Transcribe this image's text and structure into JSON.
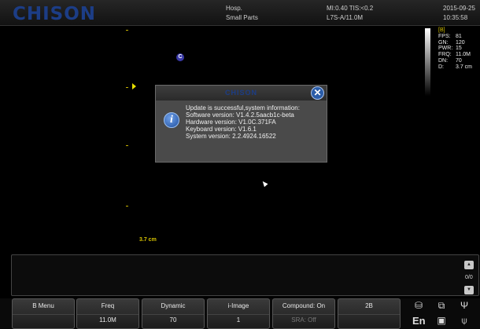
{
  "header": {
    "logo": "CHISON",
    "hospital": "Hosp.",
    "exam": "Small Parts",
    "mi_tis": "MI:0.40  TIS:<0.2",
    "probe": "L7S-A/11.0M",
    "date": "2015-09-25",
    "time": "10:35:58"
  },
  "image": {
    "center_marker": "C",
    "depth_label": "3.7 cm"
  },
  "params": {
    "mode": "[B]",
    "rows": [
      {
        "key": "FPS:",
        "value": "81"
      },
      {
        "key": "GN:",
        "value": "120"
      },
      {
        "key": "PWR:",
        "value": "15"
      },
      {
        "key": "FRQ:",
        "value": "11.0M"
      },
      {
        "key": "DN:",
        "value": "70"
      },
      {
        "key": "D:",
        "value": "3.7 cm"
      }
    ]
  },
  "dialog": {
    "title": "CHISON",
    "close": "✕",
    "info_icon": "i",
    "lines": [
      "Update is successful,system information:",
      "Software version: V1.4.2.5aacb1c-beta",
      "Hardware version: V1.0C.371FA",
      "Keyboard version: V1.6.1",
      "System version: 2.2.4924.16522"
    ]
  },
  "status": {
    "page_count": "0/0"
  },
  "menu": [
    {
      "label": "B Menu",
      "value": ""
    },
    {
      "label": "Freq",
      "value": "11.0M"
    },
    {
      "label": "Dynamic",
      "value": "70"
    },
    {
      "label": "i-Image",
      "value": "1"
    },
    {
      "label": "Compound: On",
      "value": "SRA: Off"
    },
    {
      "label": "2B",
      "value": ""
    }
  ],
  "system_icons": {
    "language": "En",
    "icons": [
      "database-icon",
      "network-icon",
      "usb-icon",
      "printer-icon"
    ]
  },
  "colors": {
    "logo": "#1c3d86",
    "depth_marks": "#c8b400",
    "close_button": "#2a5ca8"
  }
}
